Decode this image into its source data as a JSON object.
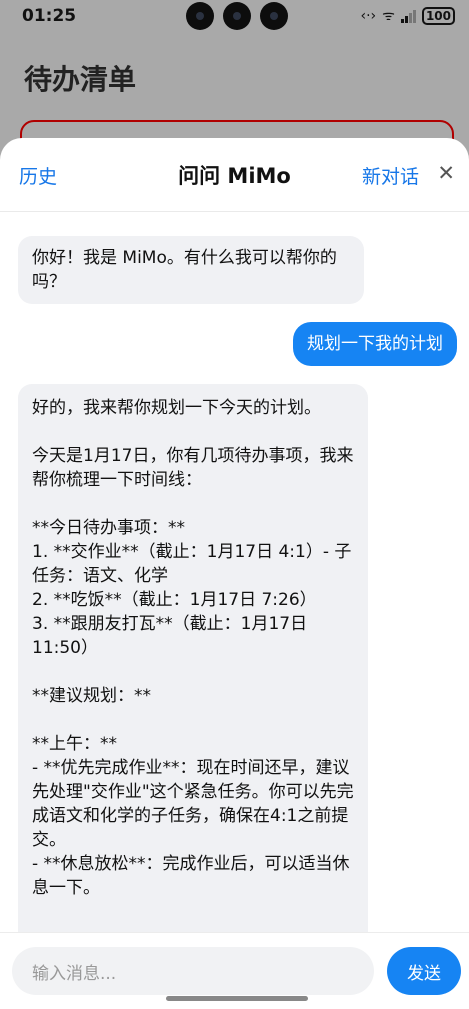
{
  "status_bar": {
    "time": "01:25",
    "icons": [
      "link-icon",
      "wifi-icon",
      "signal-icon"
    ],
    "data_glyph": "‹·›",
    "wifi_glyph": "ᯤ",
    "battery": "100"
  },
  "background_app": {
    "title": "待办清单"
  },
  "chat": {
    "history_label": "历史",
    "title": "问问 MiMo",
    "new_chat_label": "新对话",
    "close_glyph": "✕",
    "messages": [
      {
        "role": "assistant",
        "text": "你好！我是 MiMo。有什么我可以帮你的吗？"
      },
      {
        "role": "user",
        "text": "规划一下我的计划"
      },
      {
        "role": "assistant",
        "text": "好的，我来帮你规划一下今天的计划。\n\n今天是1月17日，你有几项待办事项，我来帮你梳理一下时间线：\n\n**今日待办事项：**\n1. **交作业**（截止：1月17日 4:1）- 子任务：语文、化学\n2. **吃饭**（截止：1月17日 7:26）\n3. **跟朋友打瓦**（截止：1月17日 11:50）\n\n**建议规划：**\n\n**上午：**\n- **优先完成作业**：现在时间还早，建议先处理\"交作业\"这个紧急任务。你可以先完成语文和化学的子任务，确保在4:1之前提交。\n- **休息放松**：完成作业后，可以适当休息一下。"
      }
    ],
    "input_placeholder": "输入消息...",
    "send_label": "发送"
  },
  "colors": {
    "accent": "#1684f3",
    "link": "#1777e8",
    "ai_bubble": "#f0f1f4",
    "background_card_border": "#b00000"
  }
}
